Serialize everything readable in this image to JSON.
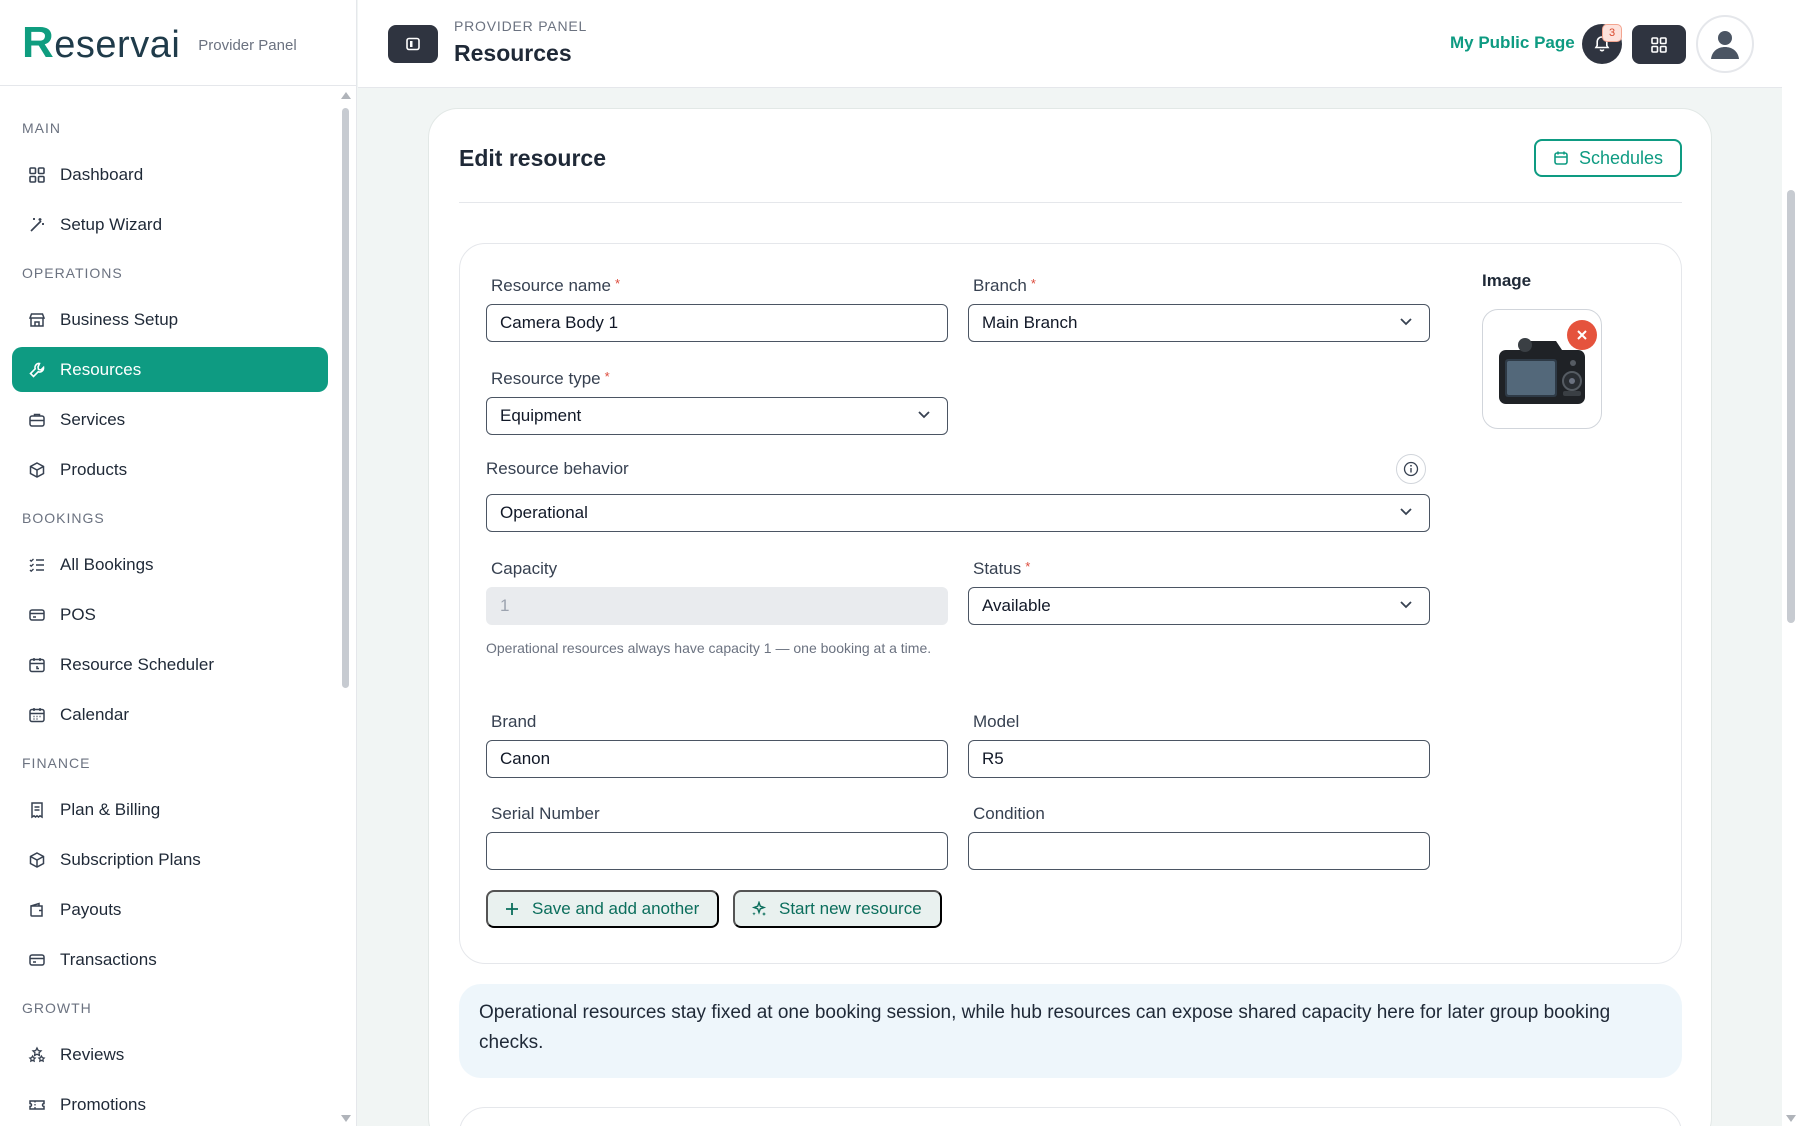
{
  "brand": {
    "logo_first": "R",
    "logo_rest": "eservai",
    "subtitle": "Provider Panel"
  },
  "sidebar": {
    "sections": [
      {
        "label": "MAIN",
        "items": [
          {
            "label": "Dashboard",
            "icon": "dashboard-icon",
            "active": false
          },
          {
            "label": "Setup Wizard",
            "icon": "wand-icon",
            "active": false
          }
        ]
      },
      {
        "label": "OPERATIONS",
        "items": [
          {
            "label": "Business Setup",
            "icon": "store-icon",
            "active": false
          },
          {
            "label": "Resources",
            "icon": "wrench-icon",
            "active": true
          },
          {
            "label": "Services",
            "icon": "briefcase-icon",
            "active": false
          },
          {
            "label": "Products",
            "icon": "box-icon",
            "active": false
          }
        ]
      },
      {
        "label": "BOOKINGS",
        "items": [
          {
            "label": "All Bookings",
            "icon": "list-check-icon",
            "active": false
          },
          {
            "label": "POS",
            "icon": "card-icon",
            "active": false
          },
          {
            "label": "Resource Scheduler",
            "icon": "calendar-clock-icon",
            "active": false
          },
          {
            "label": "Calendar",
            "icon": "calendar-icon",
            "active": false
          }
        ]
      },
      {
        "label": "FINANCE",
        "items": [
          {
            "label": "Plan & Billing",
            "icon": "receipt-icon",
            "active": false
          },
          {
            "label": "Subscription Plans",
            "icon": "box-icon",
            "active": false
          },
          {
            "label": "Payouts",
            "icon": "wallet-icon",
            "active": false
          },
          {
            "label": "Transactions",
            "icon": "card-icon",
            "active": false
          }
        ]
      },
      {
        "label": "GROWTH",
        "items": [
          {
            "label": "Reviews",
            "icon": "stars-icon",
            "active": false
          },
          {
            "label": "Promotions",
            "icon": "ticket-icon",
            "active": false
          }
        ]
      }
    ]
  },
  "topbar": {
    "breadcrumb": "PROVIDER PANEL",
    "title": "Resources",
    "public_link": "My Public Page",
    "notification_count": "3"
  },
  "card": {
    "title": "Edit resource",
    "schedules_label": "Schedules"
  },
  "form": {
    "resource_name": {
      "label": "Resource name",
      "required": "*",
      "value": "Camera Body 1"
    },
    "branch": {
      "label": "Branch",
      "required": "*",
      "value": "Main Branch"
    },
    "resource_type": {
      "label": "Resource type",
      "required": "*",
      "value": "Equipment"
    },
    "behavior": {
      "label": "Resource behavior",
      "value": "Operational"
    },
    "capacity": {
      "label": "Capacity",
      "value": "1",
      "hint": "Operational resources always have capacity 1 — one booking at a time."
    },
    "status": {
      "label": "Status",
      "required": "*",
      "value": "Available"
    },
    "brand": {
      "label": "Brand",
      "value": "Canon"
    },
    "model": {
      "label": "Model",
      "value": "R5"
    },
    "serial": {
      "label": "Serial Number",
      "value": ""
    },
    "condition": {
      "label": "Condition",
      "value": ""
    },
    "image_label": "Image",
    "save_another_label": "Save and add another",
    "start_new_label": "Start new resource"
  },
  "note": "Operational resources stay fixed at one booking session, while hub resources can expose shared capacity here for later group booking checks.",
  "colors": {
    "accent": "#0e9b82",
    "dark": "#2f3440",
    "danger": "#e5533d"
  }
}
